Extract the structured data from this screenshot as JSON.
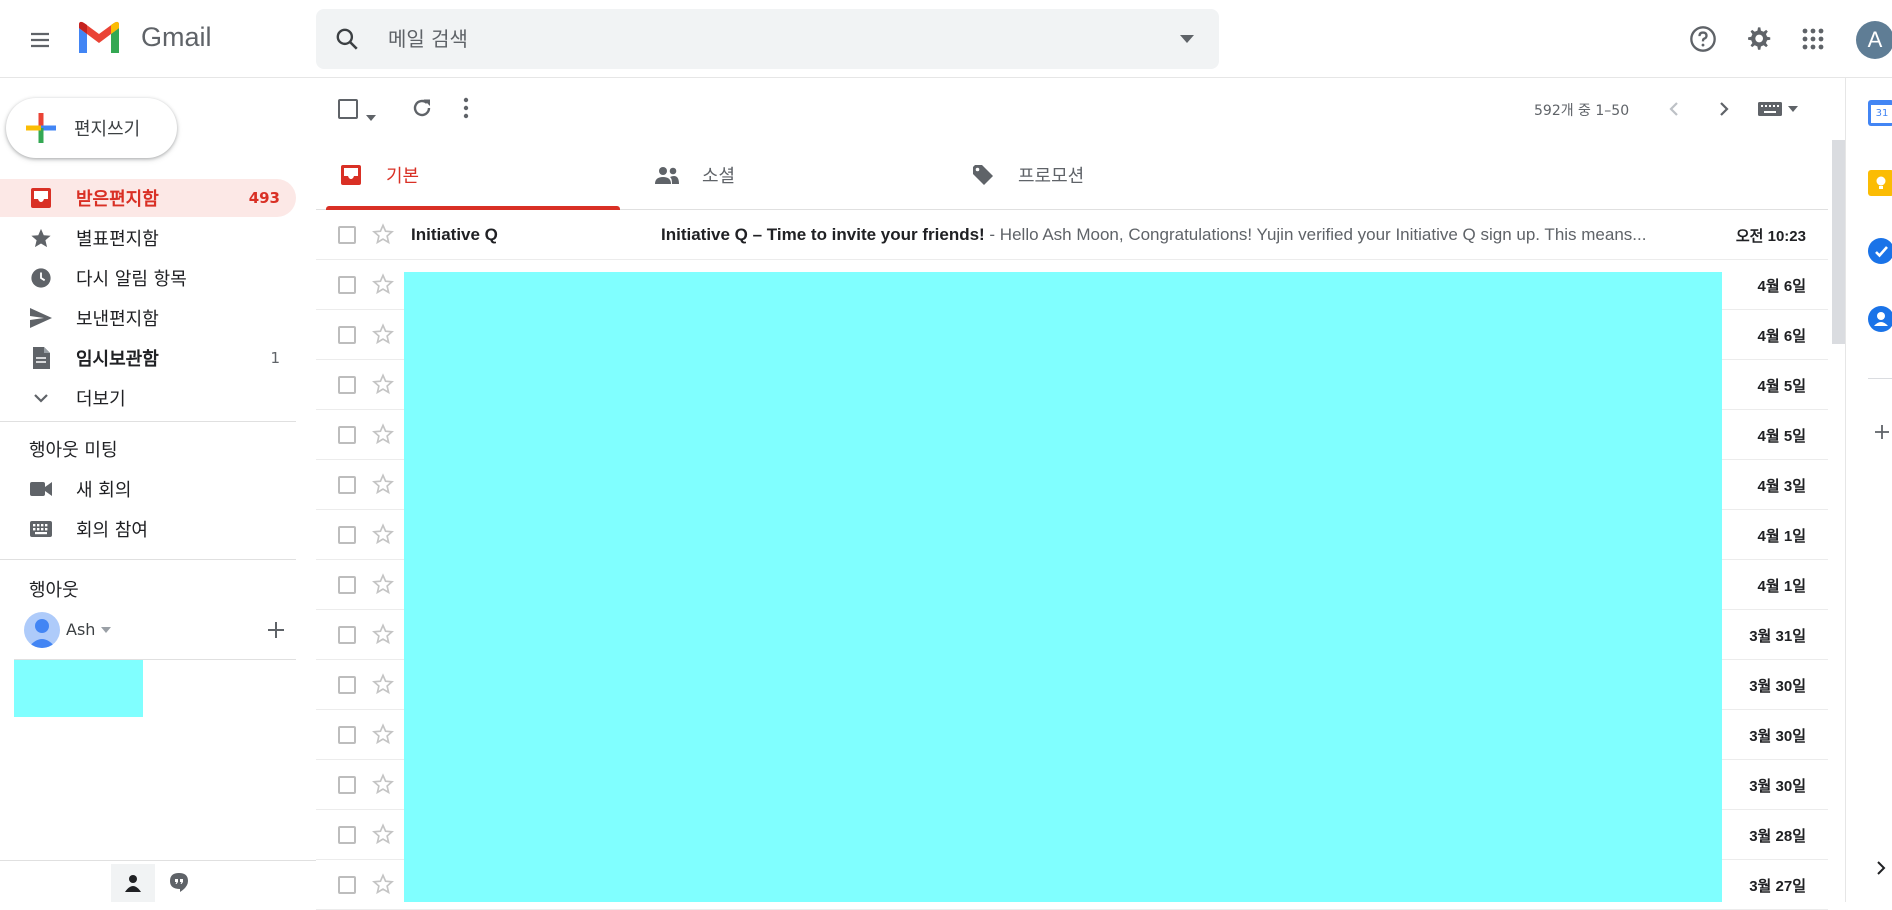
{
  "app": {
    "name": "Gmail"
  },
  "search": {
    "placeholder": "메일 검색"
  },
  "header": {
    "avatar_letter": "A"
  },
  "compose": {
    "label": "편지쓰기"
  },
  "nav": {
    "items": [
      {
        "label": "받은편지함",
        "count": "493",
        "icon": "inbox-icon",
        "active": true
      },
      {
        "label": "별표편지함",
        "count": "",
        "icon": "star-icon"
      },
      {
        "label": "다시 알림 항목",
        "count": "",
        "icon": "clock-icon"
      },
      {
        "label": "보낸편지함",
        "count": "",
        "icon": "send-icon"
      },
      {
        "label": "임시보관함",
        "count": "1",
        "icon": "draft-icon",
        "bold": true
      },
      {
        "label": "더보기",
        "count": "",
        "icon": "chevron-down-icon"
      }
    ]
  },
  "meet": {
    "title": "행아웃 미팅",
    "new_meeting": "새 회의",
    "join_meeting": "회의 참여"
  },
  "hangouts": {
    "title": "행아웃",
    "user": "Ash"
  },
  "toolbar": {
    "pagination": "592개 중 1–50"
  },
  "tabs": [
    {
      "label": "기본",
      "icon": "inbox-icon"
    },
    {
      "label": "소셜",
      "icon": "people-icon"
    },
    {
      "label": "프로모션",
      "icon": "tag-icon"
    }
  ],
  "emails": [
    {
      "sender": "Initiative Q",
      "subject": "Initiative Q – Time to invite your friends!",
      "snippet": " - Hello Ash Moon, Congratulations! Yujin verified your Initiative Q sign up. This means...",
      "date": "오전 10:23"
    },
    {
      "date": "4월 6일"
    },
    {
      "date": "4월 6일"
    },
    {
      "date": "4월 5일"
    },
    {
      "date": "4월 5일"
    },
    {
      "date": "4월 3일"
    },
    {
      "date": "4월 1일"
    },
    {
      "date": "4월 1일"
    },
    {
      "date": "3월 31일"
    },
    {
      "date": "3월 30일"
    },
    {
      "date": "3월 30일"
    },
    {
      "date": "3월 30일"
    },
    {
      "date": "3월 28일"
    },
    {
      "date": "3월 27일"
    }
  ],
  "colors": {
    "accent": "#d93025",
    "redaction": "#80ffff",
    "active_bg": "#fce8e6"
  }
}
